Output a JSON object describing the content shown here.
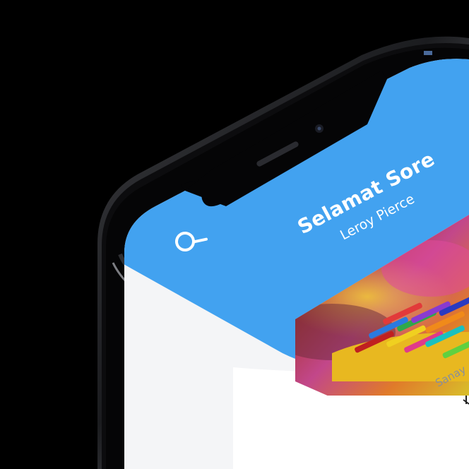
{
  "app": {
    "greeting": "Selamat Sore",
    "user_name": "Leroy Pierce",
    "accent_color": "#42a2f0"
  },
  "header": {
    "search_icon": "search-icon"
  },
  "featured_card": {
    "image_subject": "colored pencils",
    "caption": "Sanay"
  }
}
